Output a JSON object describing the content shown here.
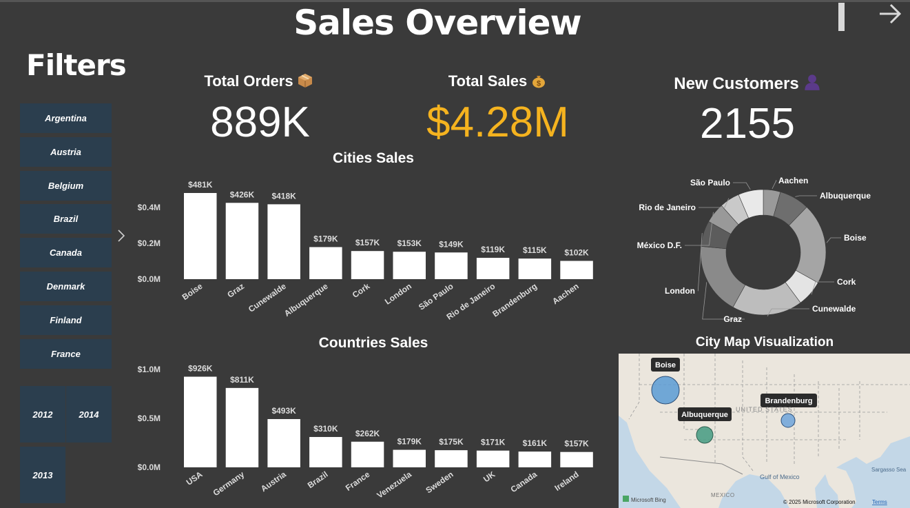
{
  "header": {
    "title": "Sales Overview"
  },
  "filters": {
    "title": "Filters",
    "countries": [
      "Argentina",
      "Austria",
      "Belgium",
      "Brazil",
      "Canada",
      "Denmark",
      "Finland",
      "France"
    ],
    "years": [
      "2012",
      "2014",
      "2013"
    ]
  },
  "icons": {
    "bookmark": "bookmark-bar-icon",
    "next": "arrow-right-icon",
    "expand": "chevron-right-icon",
    "orders": "package-icon",
    "sales": "money-bag-icon",
    "customers": "person-icon"
  },
  "kpis": {
    "orders": {
      "label": "Total Orders",
      "value": "889K",
      "color": "#ffffff"
    },
    "sales": {
      "label": "Total Sales",
      "value": "$4.28M",
      "color": "#f5b31f"
    },
    "customers": {
      "label": "New Customers",
      "value": "2155",
      "color": "#ffffff"
    }
  },
  "chart_data": [
    {
      "id": "cities",
      "type": "bar",
      "title": "Cities Sales",
      "categories": [
        "Boise",
        "Graz",
        "Cunewalde",
        "Albuquerque",
        "Cork",
        "London",
        "São Paulo",
        "Rio de Janeiro",
        "Brandenburg",
        "Aachen"
      ],
      "values": [
        481,
        426,
        418,
        179,
        157,
        153,
        149,
        119,
        115,
        102
      ],
      "data_labels": [
        "$481K",
        "$426K",
        "$418K",
        "$179K",
        "$157K",
        "$153K",
        "$149K",
        "$119K",
        "$115K",
        "$102K"
      ],
      "yticks": [
        0,
        200,
        400
      ],
      "ytick_labels": [
        "$0.0M",
        "$0.2M",
        "$0.4M"
      ],
      "ylim": [
        0,
        481
      ],
      "bar_color": "#ffffff",
      "grid": false
    },
    {
      "id": "countries",
      "type": "bar",
      "title": "Countries Sales",
      "categories": [
        "USA",
        "Germany",
        "Austria",
        "Brazil",
        "France",
        "Venezuela",
        "Sweden",
        "UK",
        "Canada",
        "Ireland"
      ],
      "values": [
        926,
        811,
        493,
        310,
        262,
        179,
        175,
        171,
        161,
        157
      ],
      "data_labels": [
        "$926K",
        "$811K",
        "$493K",
        "$310K",
        "$262K",
        "$179K",
        "$175K",
        "$171K",
        "$161K",
        "$157K"
      ],
      "yticks": [
        0,
        500,
        1000
      ],
      "ytick_labels": [
        "$0.0M",
        "$0.5M",
        "$1.0M"
      ],
      "ylim": [
        0,
        1000
      ],
      "bar_color": "#ffffff",
      "grid": false
    },
    {
      "id": "city-donut",
      "type": "pie",
      "categories": [
        "Aachen",
        "Albuquerque",
        "Boise",
        "Cork",
        "Cunewalde",
        "Graz",
        "London",
        "México D.F.",
        "Rio de Janeiro",
        "São Paulo"
      ],
      "values": [
        102,
        179,
        481,
        157,
        418,
        426,
        153,
        120,
        119,
        149
      ],
      "colors": [
        "#9a9a9a",
        "#6e6e6e",
        "#a5a5a5",
        "#e4e4e4",
        "#bdbdbd",
        "#8a8a8a",
        "#5c5c5c",
        "#999999",
        "#c9c9c9",
        "#e9e9e9"
      ],
      "donut": true
    }
  ],
  "map": {
    "title": "City Map Visualization",
    "bubbles": [
      {
        "label": "Boise",
        "color": "#5b9bd5"
      },
      {
        "label": "Albuquerque",
        "color": "#4e9e86"
      },
      {
        "label": "Brandenburg",
        "color": "#6fa3db"
      }
    ],
    "labels": [
      "UNITED STATES",
      "Gulf of Mexico",
      "MEXICO",
      "Sargasso Sea"
    ],
    "bing": "Microsoft Bing",
    "copyright": "© 2025 Microsoft Corporation",
    "terms": "Terms"
  }
}
